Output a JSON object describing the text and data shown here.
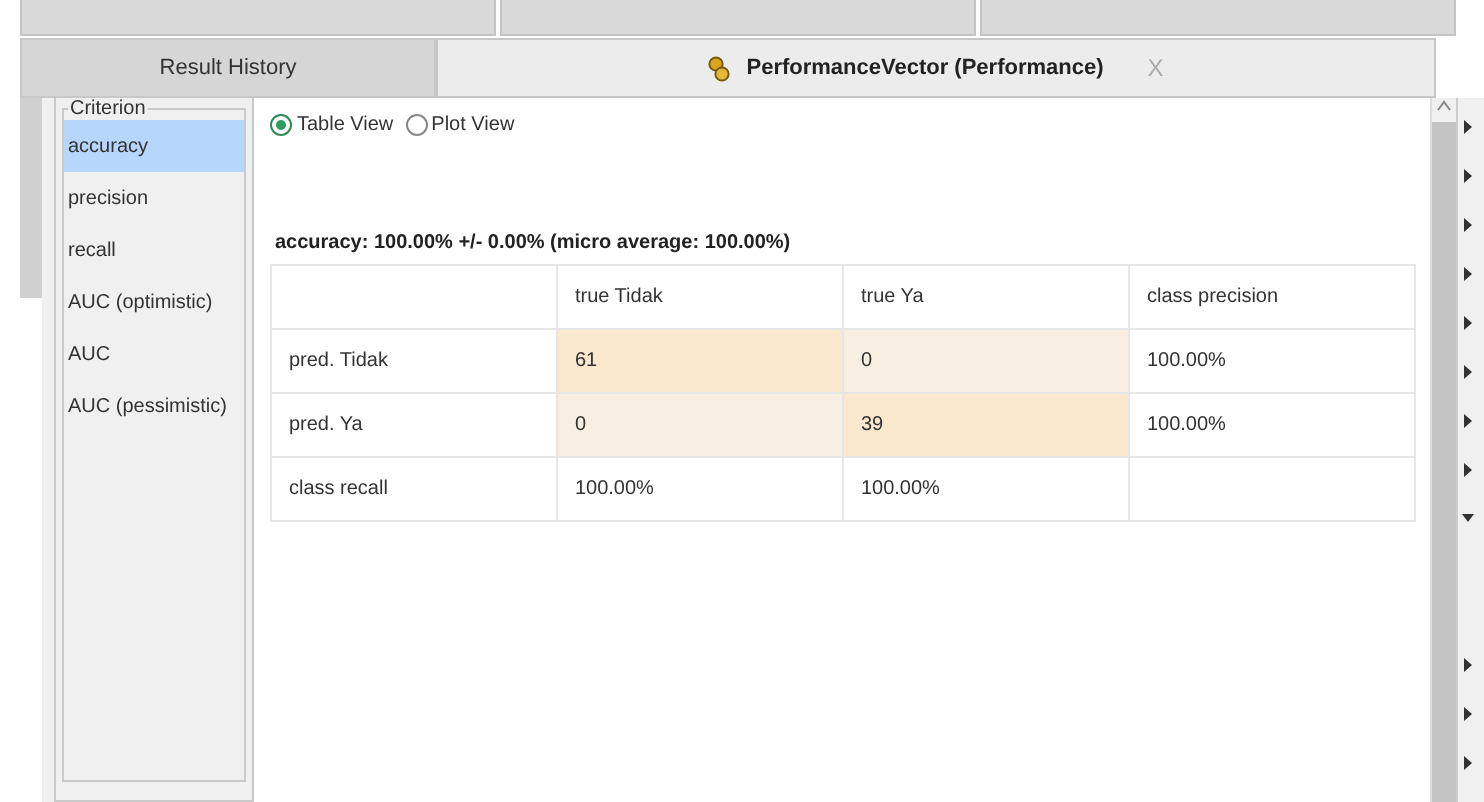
{
  "tabs": [
    {
      "label": "Result History",
      "selected": false
    },
    {
      "label": "PerformanceVector (Performance)",
      "selected": true,
      "closable": true,
      "close": "X"
    }
  ],
  "criterion": {
    "title": "Criterion",
    "items": [
      {
        "label": "accuracy",
        "selected": true
      },
      {
        "label": "precision",
        "selected": false
      },
      {
        "label": "recall",
        "selected": false
      },
      {
        "label": "AUC (optimistic)",
        "selected": false
      },
      {
        "label": "AUC",
        "selected": false
      },
      {
        "label": "AUC (pessimistic)",
        "selected": false
      }
    ]
  },
  "views": [
    {
      "label": "Table View",
      "selected": true
    },
    {
      "label": "Plot View",
      "selected": false
    }
  ],
  "summary": "accuracy: 100.00% +/- 0.00% (micro average: 100.00%)",
  "table": {
    "columns": [
      "",
      "true Tidak",
      "true Ya",
      "class precision"
    ],
    "rows": [
      [
        {
          "text": "pred. Tidak",
          "kind": "plain"
        },
        {
          "text": "61",
          "kind": "strong"
        },
        {
          "text": "0",
          "kind": "weak"
        },
        {
          "text": "100.00%",
          "kind": "plain"
        }
      ],
      [
        {
          "text": "pred. Ya",
          "kind": "plain"
        },
        {
          "text": "0",
          "kind": "weak"
        },
        {
          "text": "39",
          "kind": "strong"
        },
        {
          "text": "100.00%",
          "kind": "plain"
        }
      ],
      [
        {
          "text": "class recall",
          "kind": "plain"
        },
        {
          "text": "100.00%",
          "kind": "plain"
        },
        {
          "text": "100.00%",
          "kind": "plain"
        },
        {
          "text": "",
          "kind": "plain"
        }
      ]
    ]
  }
}
